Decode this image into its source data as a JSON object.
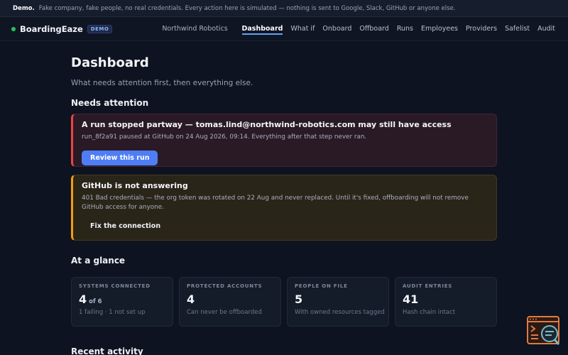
{
  "demo_bar": {
    "label": "Demo.",
    "text": "Fake company, fake people, no real credentials. Every action here is simulated — nothing is sent to Google, Slack, GitHub or anyone else."
  },
  "header": {
    "brand": "BoardingEaze",
    "badge": "DEMO",
    "org": "Northwind Robotics",
    "nav": [
      "Dashboard",
      "What if",
      "Onboard",
      "Offboard",
      "Runs",
      "Employees",
      "Providers",
      "Safelist",
      "Audit"
    ],
    "active_nav": "Dashboard"
  },
  "page": {
    "title": "Dashboard",
    "subtitle": "What needs attention first, then everything else."
  },
  "attention": {
    "title": "Needs attention",
    "alerts": [
      {
        "title": "A run stopped partway — tomas.lind@northwind-robotics.com may still have access",
        "body": "run_8f2a91 paused at GitHub on 24 Aug 2026, 09:14. Everything after that step never ran.",
        "action": "Review this run"
      },
      {
        "title": "GitHub is not answering",
        "body": "401 Bad credentials — the org token was rotated on 22 Aug and never replaced. Until it's fixed, offboarding will not remove GitHub access for anyone.",
        "action": "Fix the connection"
      }
    ]
  },
  "glance": {
    "title": "At a glance",
    "stats": [
      {
        "label": "SYSTEMS CONNECTED",
        "value": "4",
        "suffix": "of 6",
        "note": "1 failing · 1 not set up"
      },
      {
        "label": "PROTECTED ACCOUNTS",
        "value": "4",
        "suffix": "",
        "note": "Can never be offboarded"
      },
      {
        "label": "PEOPLE ON FILE",
        "value": "5",
        "suffix": "",
        "note": "With owned resources tagged"
      },
      {
        "label": "AUDIT ENTRIES",
        "value": "41",
        "suffix": "",
        "note": "Hash chain intact"
      }
    ]
  },
  "recent": {
    "title": "Recent activity"
  },
  "colors": {
    "accent": "#4f7df5",
    "danger": "#ef4444",
    "warning": "#f59e0b",
    "status_ok": "#22c55e"
  },
  "icons": {
    "brand_status": "status-dot-icon",
    "helper": "terminal-search-icon"
  }
}
